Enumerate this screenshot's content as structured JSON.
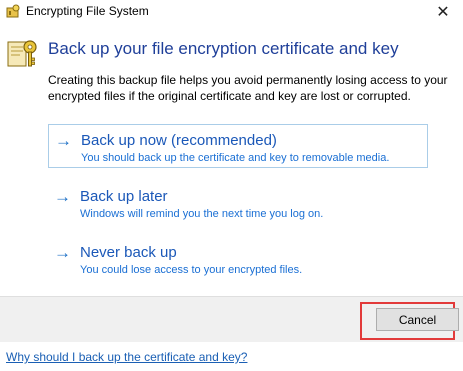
{
  "window": {
    "title": "Encrypting File System",
    "close_glyph": "✕"
  },
  "main": {
    "heading": "Back up your file encryption certificate and key",
    "description": "Creating this backup file helps you avoid permanently losing access to your encrypted files if the original certificate and key are lost or corrupted.",
    "arrow_glyph": "→",
    "options": [
      {
        "title": "Back up now (recommended)",
        "subtitle": "You should back up the certificate and key to removable media."
      },
      {
        "title": "Back up later",
        "subtitle": "Windows will remind you the next time you log on."
      },
      {
        "title": "Never back up",
        "subtitle": "You could lose access to your encrypted files."
      }
    ]
  },
  "footer": {
    "cancel_label": "Cancel",
    "help_link": "Why should I back up the certificate and key?"
  },
  "colors": {
    "heading": "#1f3f99",
    "link": "#1b58b8",
    "highlight": "#e23a3a"
  },
  "icons": {
    "title": "key-lock-icon",
    "header": "key-certificate-icon"
  }
}
